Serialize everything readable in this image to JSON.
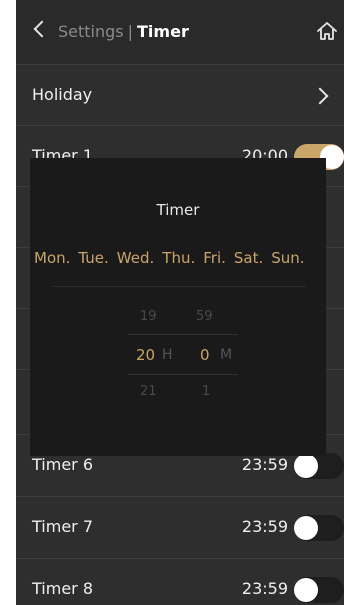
{
  "header": {
    "back_label": "Settings",
    "separator": "|",
    "title": "Timer"
  },
  "rows": [
    {
      "label": "Holiday"
    },
    {
      "label": "Timer 1",
      "time": "20:00",
      "enabled": true
    },
    {
      "label": "Timer 6",
      "time": "23:59",
      "enabled": false
    },
    {
      "label": "Timer 7",
      "time": "23:59",
      "enabled": false
    },
    {
      "label": "Timer 8",
      "time": "23:59",
      "enabled": false
    }
  ],
  "modal": {
    "title": "Timer",
    "days": [
      "Mon.",
      "Tue.",
      "Wed.",
      "Thu.",
      "Fri.",
      "Sat.",
      "Sun."
    ],
    "hour_prev": "19",
    "hour_selected": "20",
    "hour_next": "21",
    "hour_unit": "H",
    "minute_prev": "59",
    "minute_selected": "0",
    "minute_next": "1",
    "minute_unit": "M"
  },
  "colors": {
    "accent": "#caa66a",
    "background": "#2e2e2e",
    "modal_background": "#1a1a1a"
  },
  "icons": {
    "back": "chevron-left-icon",
    "home": "home-icon",
    "forward": "chevron-right-icon"
  }
}
